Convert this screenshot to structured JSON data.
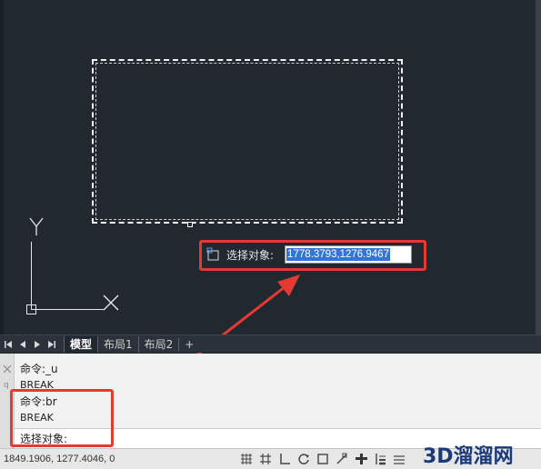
{
  "drawing": {
    "ucs_y_label": "Y",
    "ucs_x_label": "X"
  },
  "dynamic_input": {
    "label": "选择对象:",
    "value": "1778.3793,1276.9467"
  },
  "layout_tabs": [
    {
      "label": "模型",
      "active": true
    },
    {
      "label": "布局1",
      "active": false
    },
    {
      "label": "布局2",
      "active": false
    }
  ],
  "layout_tab_add": "+",
  "command_history": [
    "命令:_u",
    "BREAK",
    "命令:br",
    "BREAK"
  ],
  "command_prompt": "选择对象:",
  "command_sidebar_label": "q",
  "status": {
    "coordinates": "1849.1906, 1277.4046, 0"
  },
  "watermark": {
    "prefix": "3D",
    "text": "溜溜网"
  },
  "colors": {
    "canvas_bg": "#212830",
    "highlight_red": "#e53a32",
    "selection_blue": "#3375d6"
  }
}
